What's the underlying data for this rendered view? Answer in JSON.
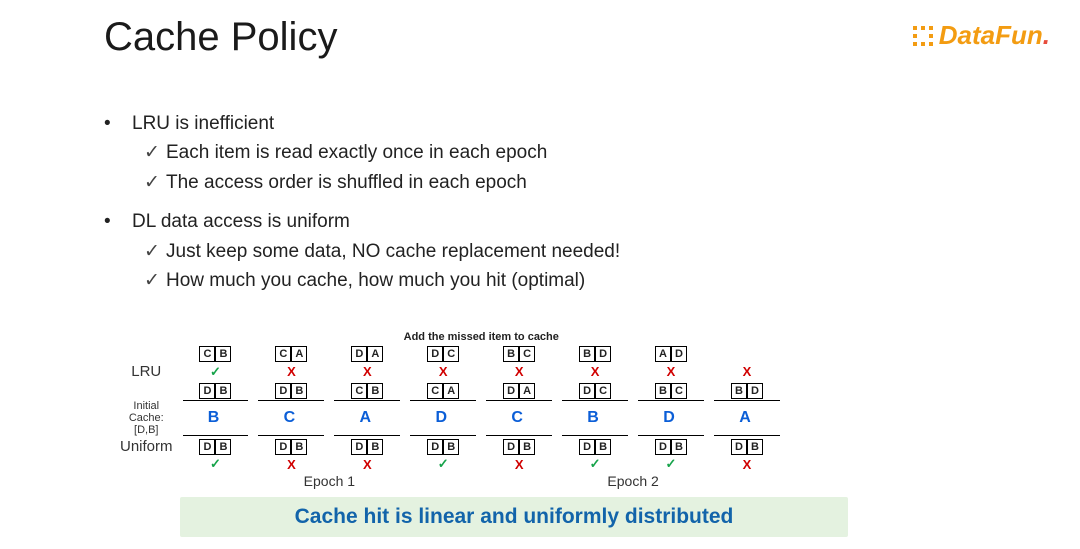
{
  "brand": {
    "name": "DataFun",
    "period": "."
  },
  "title": "Cache Policy",
  "bullets": {
    "b1": {
      "text": "LRU is inefficient",
      "s1": "Each item is read exactly once in each epoch",
      "s2": "The access order is shuffled in each epoch"
    },
    "b2": {
      "text": "DL data access is uniform",
      "s1": "Just keep some data, NO cache replacement needed!",
      "s2": "How much you cache, how much you hit (optimal)"
    }
  },
  "diagram": {
    "caption": "Add the missed  item to cache",
    "initcache": "Initial Cache: [D,B]",
    "lru_label": "LRU",
    "uniform_label": "Uniform",
    "epoch1": "Epoch 1",
    "epoch2": "Epoch 2",
    "access": [
      "B",
      "C",
      "A",
      "D",
      "C",
      "B",
      "D",
      "A"
    ],
    "lru_pairs": [
      [
        "D",
        "B"
      ],
      [
        "C",
        "B"
      ],
      [
        "C",
        "A"
      ],
      [
        "D",
        "A"
      ],
      [
        "D",
        "C"
      ],
      [
        "B",
        "C"
      ],
      [
        "B",
        "D"
      ],
      [
        "A",
        "D"
      ]
    ],
    "lru_marks": [
      "✓",
      "X",
      "X",
      "X",
      "X",
      "X",
      "X",
      "X"
    ],
    "uni_pairs": [
      [
        "D",
        "B"
      ],
      [
        "D",
        "B"
      ],
      [
        "D",
        "B"
      ],
      [
        "D",
        "B"
      ],
      [
        "D",
        "B"
      ],
      [
        "D",
        "B"
      ],
      [
        "D",
        "B"
      ],
      [
        "D",
        "B"
      ]
    ],
    "uni_marks": [
      "✓",
      "X",
      "X",
      "✓",
      "X",
      "✓",
      "✓",
      "X"
    ]
  },
  "callout": "Cache hit is linear and uniformly distributed"
}
